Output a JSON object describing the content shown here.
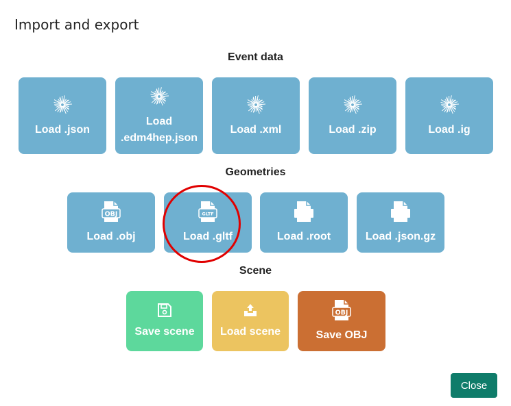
{
  "dialog": {
    "title": "Import and export",
    "close_label": "Close"
  },
  "sections": {
    "event_data": {
      "title": "Event data",
      "tiles": [
        {
          "label": "Load .json",
          "icon": "burst-icon"
        },
        {
          "label": "Load .edm4hep.json",
          "label_line1": "Load",
          "label_line2": ".edm4hep.json",
          "icon": "burst-icon"
        },
        {
          "label": "Load .xml",
          "icon": "burst-icon"
        },
        {
          "label": "Load .zip",
          "icon": "burst-icon"
        },
        {
          "label": "Load .ig",
          "icon": "burst-icon"
        }
      ]
    },
    "geometries": {
      "title": "Geometries",
      "tiles": [
        {
          "label": "Load .obj",
          "icon": "obj-file-icon",
          "icon_text": "OBJ"
        },
        {
          "label": "Load .gltf",
          "icon": "gltf-file-icon",
          "icon_text": "GLTF"
        },
        {
          "label": "Load .root",
          "icon": "file-icon"
        },
        {
          "label": "Load .json.gz",
          "icon": "file-icon"
        }
      ]
    },
    "scene": {
      "title": "Scene",
      "tiles": [
        {
          "label": "Save scene",
          "icon": "save-icon"
        },
        {
          "label": "Load scene",
          "icon": "inbox-upload-icon"
        },
        {
          "label": "Save OBJ",
          "icon": "obj-file-icon",
          "icon_text": "OBJ"
        }
      ]
    }
  },
  "colors": {
    "tile_blue": "#6fb0d0",
    "tile_green": "#5dd89c",
    "tile_yellow": "#ecc460",
    "tile_orange": "#cb6f33",
    "close_button": "#0f7c6a",
    "highlight_circle": "#e00000"
  }
}
